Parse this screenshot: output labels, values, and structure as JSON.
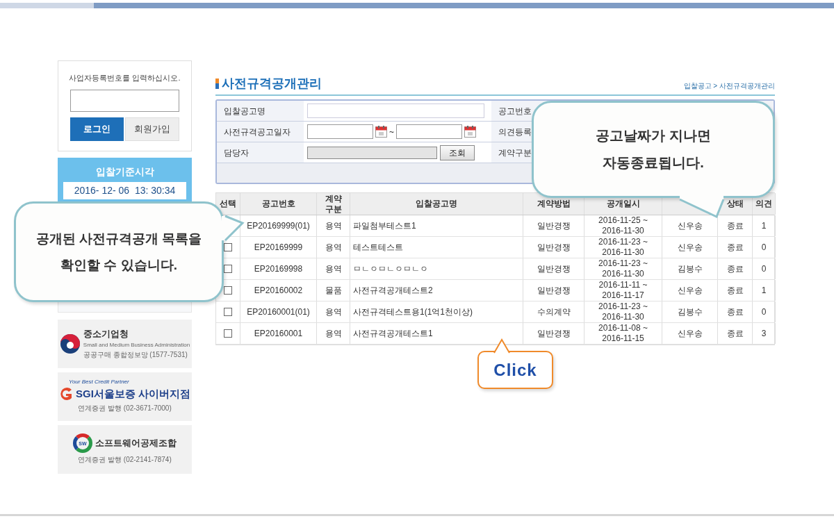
{
  "login": {
    "prompt": "사업자등록번호를 입력하십시오.",
    "buttons": [
      {
        "label": "로그인",
        "kind": "primary"
      },
      {
        "label": "회원가입",
        "kind": "secondary"
      }
    ]
  },
  "clock": {
    "title": "입찰기준시각",
    "time": "2016- 12- 06  13: 30:34"
  },
  "partners": [
    {
      "kind": "taeguk",
      "name": "중소기업청",
      "subtitle": "Small and Medium Business Administration",
      "note": "공공구매 종합정보망 (1577-7531)"
    },
    {
      "kind": "sgi",
      "tagline": "Your Best Credit Partner",
      "name": "SGI서울보증 사이버지점",
      "note": "연계증권 발행 (02-3671-7000)"
    },
    {
      "kind": "sw",
      "badge": "SW",
      "name": "소프트웨어공제조합",
      "note": "연계증권 발행 (02-2141-7874)"
    }
  ],
  "page": {
    "title": "사전규격공개관리",
    "breadcrumb": "입찰공고 > 사전규격공개관리"
  },
  "search": {
    "rows": [
      {
        "label": "입찰공고명",
        "kind": "text",
        "right_label": "공고번호"
      },
      {
        "label": "사전규격공고일자",
        "kind": "date_range",
        "separator": "~",
        "right_label": "의견등록"
      },
      {
        "label": "담당자",
        "kind": "lookup",
        "button": "조회",
        "right_label": "계약구분"
      }
    ]
  },
  "table": {
    "columns": [
      {
        "lines": [
          "선택"
        ]
      },
      {
        "lines": [
          "공고번호"
        ]
      },
      {
        "lines": [
          "계약",
          "구분"
        ]
      },
      {
        "lines": [
          "입찰공고명"
        ]
      },
      {
        "lines": [
          "계약방법"
        ]
      },
      {
        "lines": [
          "공개일시"
        ]
      },
      {
        "covered": true
      },
      {
        "lines": [
          "상태"
        ]
      },
      {
        "lines": [
          "의견"
        ]
      }
    ],
    "rows": [
      {
        "number": "EP20169999(01)",
        "type": "용역",
        "name": "파일첨부테스트1",
        "method": "일반경쟁",
        "period": [
          "2016-11-25 ~",
          "2016-11-30"
        ],
        "manager": "신우송",
        "status": "종료",
        "count": "1"
      },
      {
        "checked": false,
        "number": "EP20169999",
        "type": "용역",
        "name": "테스트테스트",
        "method": "일반경쟁",
        "period": [
          "2016-11-23 ~",
          "2016-11-30"
        ],
        "manager": "신우송",
        "status": "종료",
        "count": "0"
      },
      {
        "checked": false,
        "number": "EP20169998",
        "type": "용역",
        "name": "ㅁㄴㅇㅁㄴㅇㅁㄴㅇ",
        "method": "일반경쟁",
        "period": [
          "2016-11-23 ~",
          "2016-11-30"
        ],
        "manager": "김봉수",
        "status": "종료",
        "count": "0"
      },
      {
        "checked": false,
        "number": "EP20160002",
        "type": "물품",
        "name": "사전규격공개테스트2",
        "method": "일반경쟁",
        "period": [
          "2016-11-11 ~",
          "2016-11-17"
        ],
        "manager": "신우송",
        "status": "종료",
        "count": "1"
      },
      {
        "checked": false,
        "number": "EP20160001(01)",
        "type": "용역",
        "name": "사전규격테스트용1(1억1천이상)",
        "method": "수의계약",
        "period": [
          "2016-11-23 ~",
          "2016-11-30"
        ],
        "manager": "김봉수",
        "status": "종료",
        "count": "0"
      },
      {
        "checked": false,
        "number": "EP20160001",
        "type": "용역",
        "name": "사전규격공개테스트1",
        "method": "일반경쟁",
        "period": [
          "2016-11-08 ~",
          "2016-11-15"
        ],
        "manager": "신우송",
        "status": "종료",
        "count": "3"
      }
    ]
  },
  "callouts": [
    {
      "kind": "top_right",
      "lines": [
        "공고날짜가 지나면",
        "자동종료됩니다."
      ]
    },
    {
      "kind": "left",
      "lines": [
        "공개된 사전규격공개 목록을",
        "확인할 수 있습니다."
      ]
    },
    {
      "kind": "click",
      "lines": [
        "Click"
      ]
    }
  ]
}
